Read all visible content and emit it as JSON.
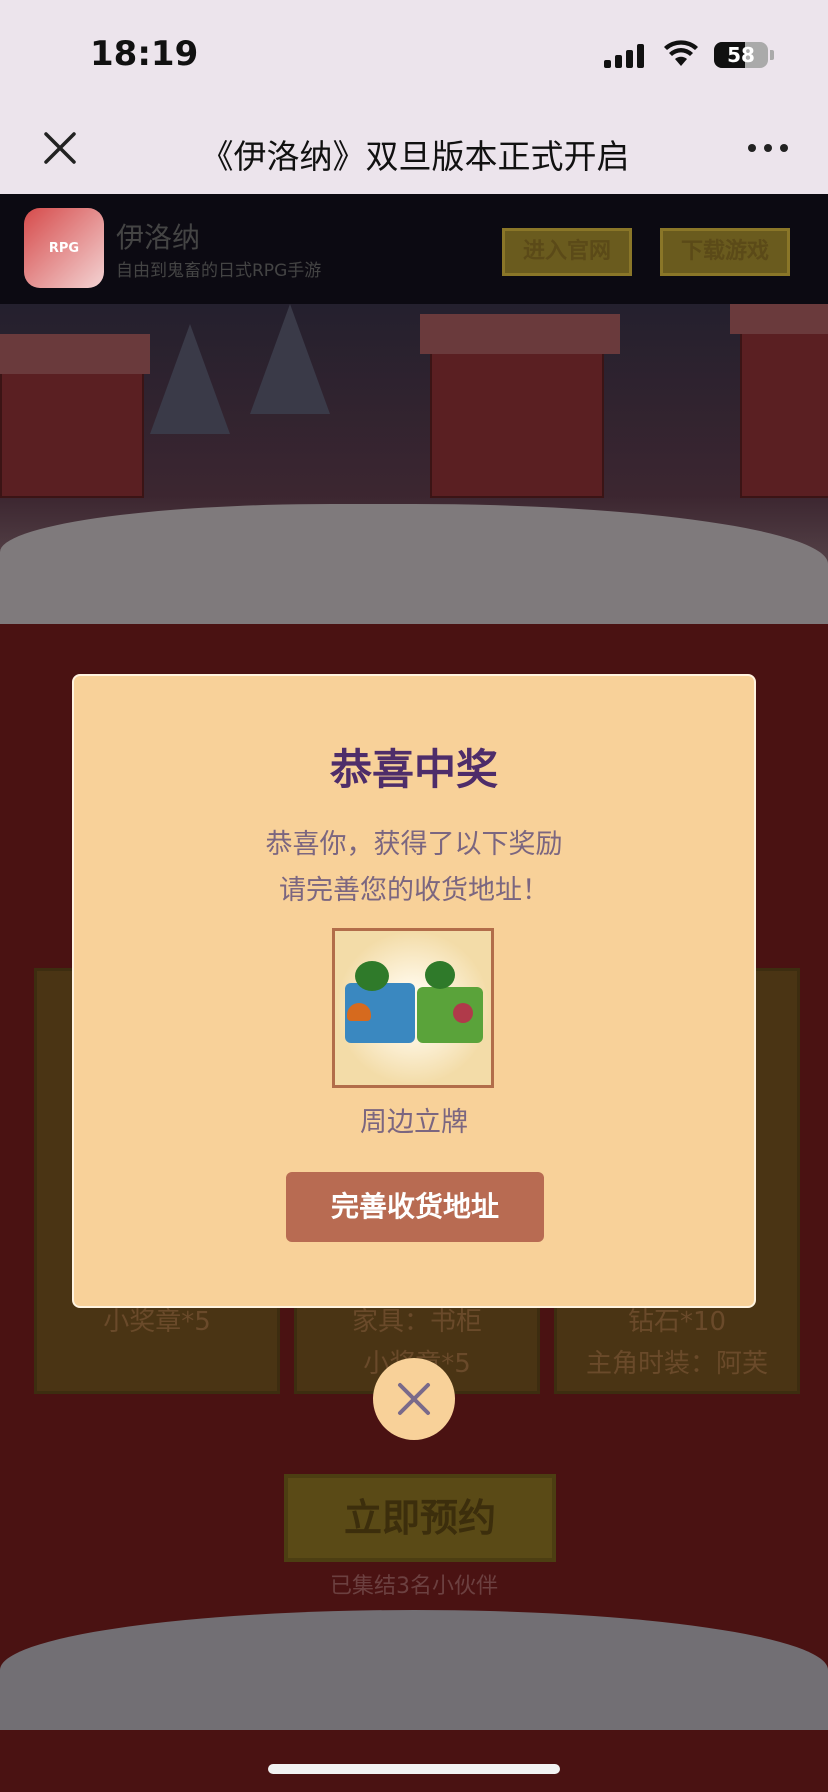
{
  "status_bar": {
    "time": "18:19",
    "battery": "58"
  },
  "navbar": {
    "title": "《伊洛纳》双旦版本正式开启"
  },
  "banner": {
    "app_name": "伊洛纳",
    "app_desc": "自由到鬼畜的日式RPG手游",
    "enter_site": "进入官网",
    "download": "下载游戏"
  },
  "background": {
    "card_texts": [
      "小奖章*5",
      "家具：书柜",
      "小奖章*5",
      "钻石*10",
      "主角时装：阿芙"
    ],
    "reserve_label": "立即预约",
    "reserve_count": "已集结3名小伙伴"
  },
  "modal": {
    "title": "恭喜中奖",
    "line1": "恭喜你，获得了以下奖励",
    "line2": "请完善您的收货地址！",
    "prize_name": "周边立牌",
    "address_button": "完善收货地址"
  },
  "colors": {
    "modal_bg": "#f8d199",
    "modal_title": "#4e2d6a",
    "button": "#b86b52"
  }
}
